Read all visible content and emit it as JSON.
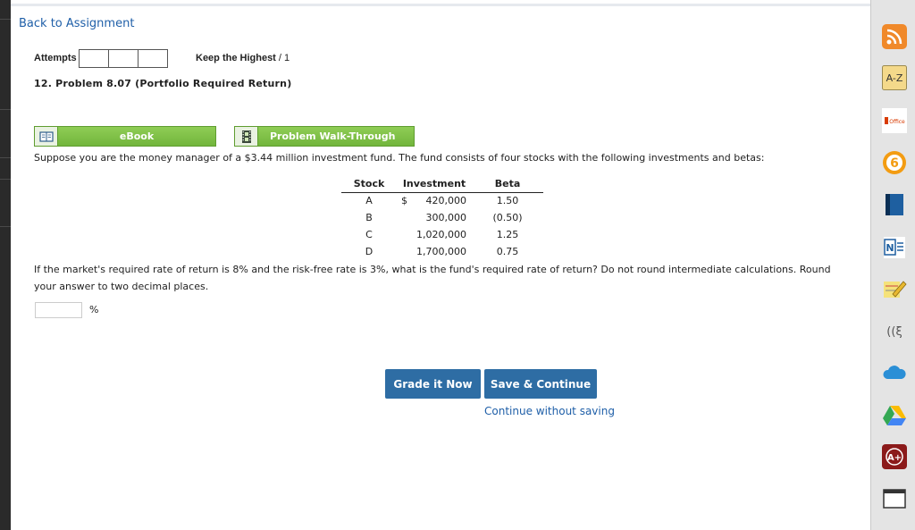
{
  "nav": {
    "back_label": "Back to Assignment"
  },
  "attempts": {
    "label": "Attempts",
    "keep_bold": "Keep the Highest",
    "keep_suffix": " / 1"
  },
  "problem": {
    "title": "12.  Problem 8.07 (Portfolio Required Return)"
  },
  "resources": {
    "ebook_label": "eBook",
    "walkthrough_label": "Problem Walk-Through"
  },
  "question": {
    "intro": "Suppose you are the money manager of a $3.44 million investment fund. The fund consists of four stocks with the following investments and betas:",
    "prompt": "If the market's required rate of return is 8% and the risk-free rate is 3%, what is the fund's required rate of return? Do not round intermediate calculations. Round your answer to two decimal places."
  },
  "table": {
    "headers": [
      "Stock",
      "Investment",
      "Beta"
    ],
    "currency_symbol": "$",
    "rows": [
      [
        "A",
        "420,000",
        "1.50"
      ],
      [
        "B",
        "300,000",
        "(0.50)"
      ],
      [
        "C",
        "1,020,000",
        "1.25"
      ],
      [
        "D",
        "1,700,000",
        "0.75"
      ]
    ]
  },
  "answer": {
    "value": "",
    "unit": "%"
  },
  "actions": {
    "grade_label": "Grade it Now",
    "save_label": "Save & Continue",
    "continue_label": "Continue without saving"
  },
  "extensions": [
    {
      "name": "rss-icon",
      "glyph": "",
      "color": "#f0892a"
    },
    {
      "name": "a-z-icon",
      "glyph": "A-Z",
      "color": "#f4d98a"
    },
    {
      "name": "office-icon",
      "glyph": "Office",
      "color": "#ffffff"
    },
    {
      "name": "six-icon",
      "glyph": "6",
      "color": "#f39c12"
    },
    {
      "name": "book-icon",
      "glyph": "",
      "color": "#1e5fa0"
    },
    {
      "name": "notes-icon",
      "glyph": "N",
      "color": "#ffffff"
    },
    {
      "name": "notepad-pencil-icon",
      "glyph": "",
      "color": "#f5e27a"
    },
    {
      "name": "speech-icon",
      "glyph": "((ξ",
      "color": "#555555"
    },
    {
      "name": "cloud-icon",
      "glyph": "",
      "color": "#2b8fd6"
    },
    {
      "name": "drive-icon",
      "glyph": "",
      "color": "#34a853"
    },
    {
      "name": "a-plus-icon",
      "glyph": "A+",
      "color": "#8b1a1a"
    },
    {
      "name": "screen-icon",
      "glyph": "",
      "color": "#ffffff"
    }
  ]
}
